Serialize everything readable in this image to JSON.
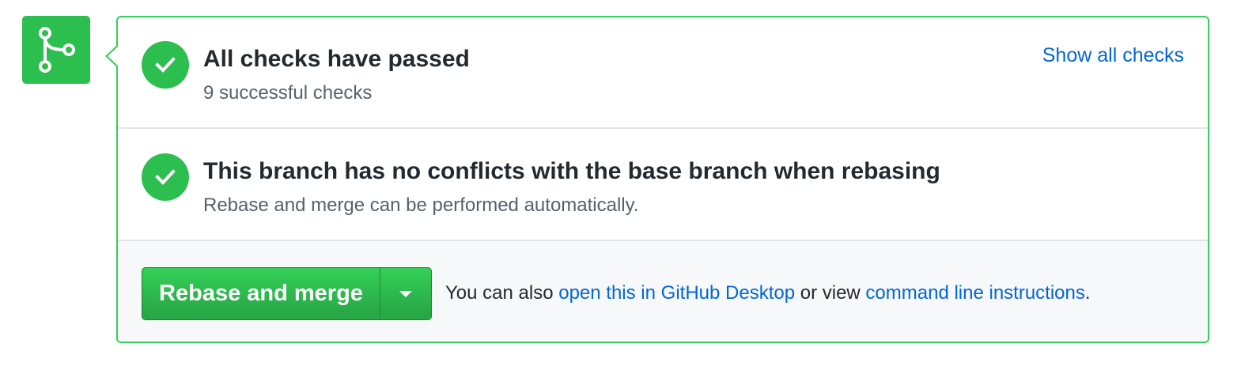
{
  "merge_status": {
    "icon": "git-merge-icon",
    "color": "#2cbe4e"
  },
  "checks": {
    "title": "All checks have passed",
    "description": "9 successful checks",
    "show_all_label": "Show all checks",
    "icon": "check-icon"
  },
  "conflicts": {
    "title": "This branch has no conflicts with the base branch when rebasing",
    "description": "Rebase and merge can be performed automatically.",
    "icon": "check-icon"
  },
  "merge": {
    "button_label": "Rebase and merge",
    "dropdown_icon": "caret-down-icon",
    "alt_prefix": "You can also ",
    "desktop_link": "open this in GitHub Desktop",
    "alt_middle": " or view ",
    "cli_link": "command line instructions",
    "alt_suffix": "."
  },
  "colors": {
    "success": "#2cbe4e",
    "border": "#34d058",
    "link": "#0366d6",
    "muted_text": "#586069",
    "footer_bg": "#f6f8fa"
  }
}
